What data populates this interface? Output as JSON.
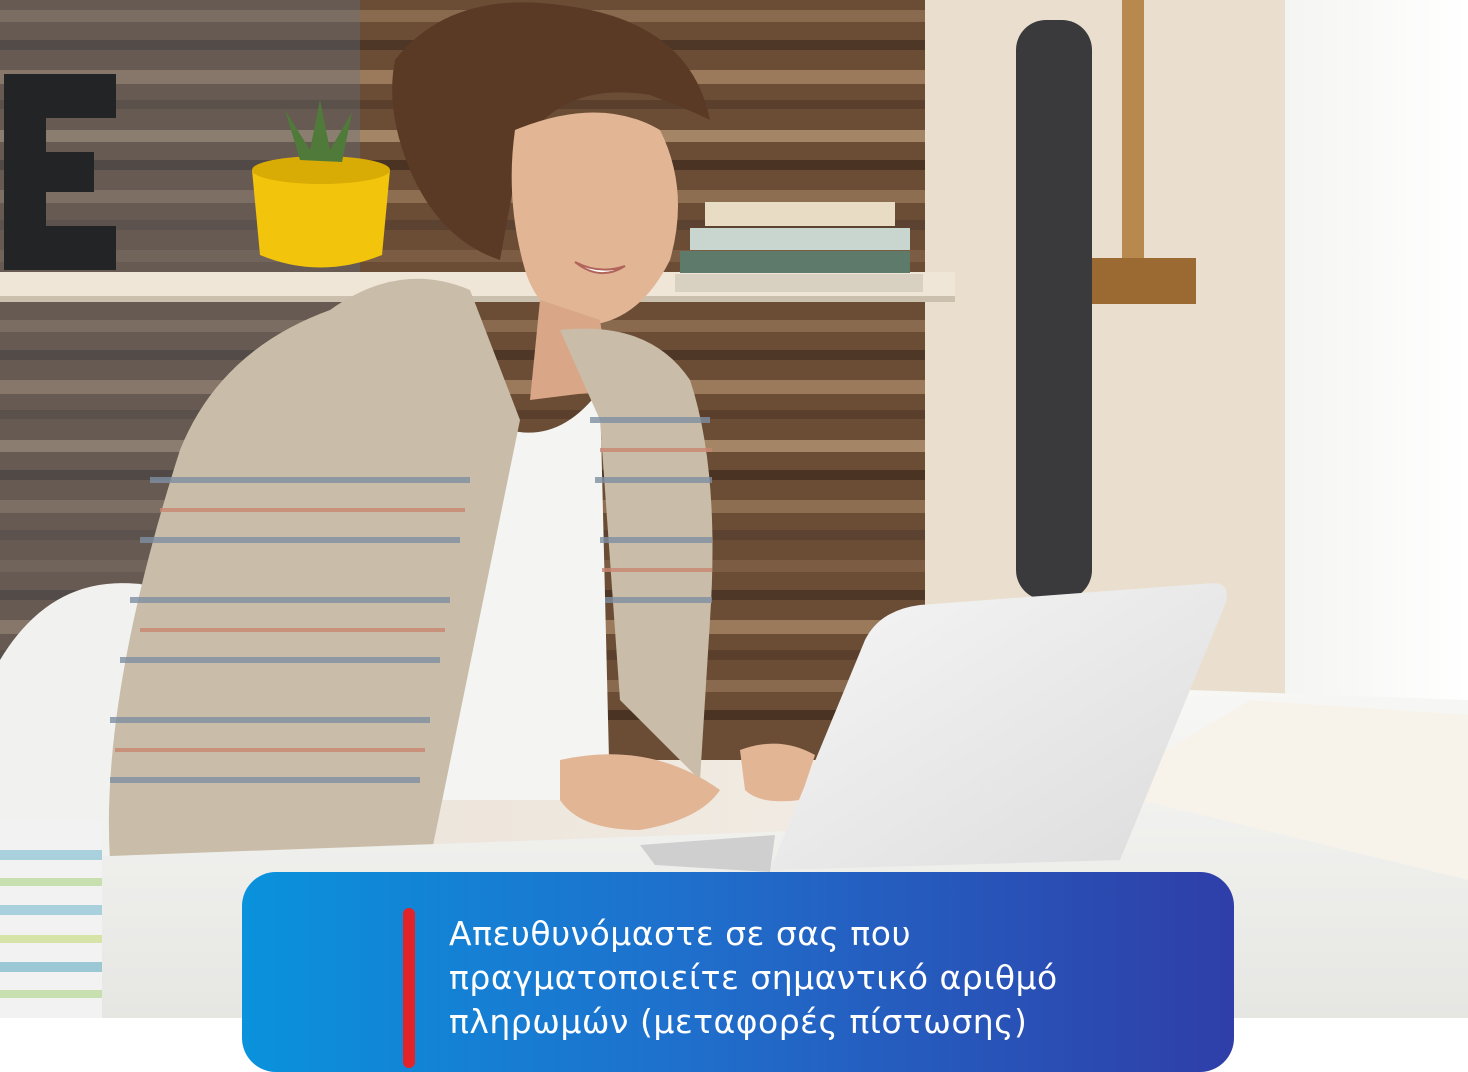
{
  "hero": {
    "image_alt": "Photo of a smiling woman working on a laptop at a desk",
    "colors": {
      "wall": "#f1ebe3",
      "wood": "#6b4d36",
      "shelf": "#efe6d8",
      "plant_pot": "#f2c40b",
      "desk": "#f5f5f3"
    }
  },
  "card": {
    "text": "Απευθυνόμαστε σε σας που πραγματοποιείτε σημαντικό αριθμό πληρωμών (μεταφορές πίστωσης)",
    "colors": {
      "gradient_start": "#0a92dc",
      "gradient_end": "#2f3ea8",
      "accent": "#e2232a",
      "text": "#ffffff"
    }
  }
}
